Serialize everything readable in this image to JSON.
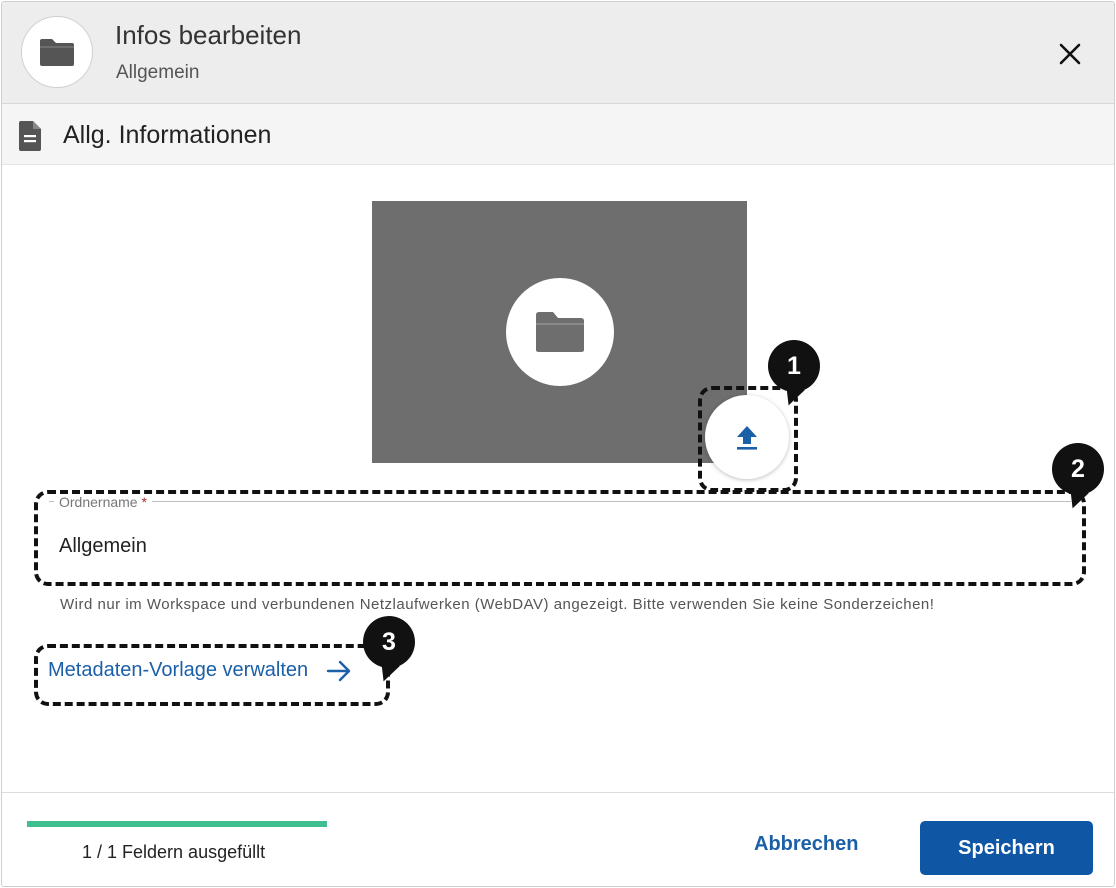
{
  "header": {
    "title": "Infos bearbeiten",
    "subtitle": "Allgemein",
    "icon": "folder-icon",
    "close_icon": "close-icon"
  },
  "section": {
    "title": "Allg. Informationen",
    "icon": "document-icon"
  },
  "image": {
    "placeholder_icon": "folder-icon",
    "upload_icon": "upload-icon"
  },
  "form": {
    "folder_name_label": "Ordnername",
    "required_mark": "*",
    "folder_name_value": "Allgemein",
    "hint": "Wird nur im Workspace und verbundenen Netzlaufwerken (WebDAV) angezeigt. Bitte verwenden Sie keine Sonderzeichen!"
  },
  "metadata_link": {
    "label": "Metadaten-Vorlage verwalten",
    "icon": "arrow-right-icon"
  },
  "annotations": {
    "c1": "1",
    "c2": "2",
    "c3": "3"
  },
  "footer": {
    "progress_fraction": 1.0,
    "progress_text": "1 / 1 Feldern ausgefüllt",
    "cancel_label": "Abbrechen",
    "save_label": "Speichern"
  },
  "colors": {
    "accent": "#0f57a4",
    "link": "#1b5fa8",
    "progress": "#3fbf8f",
    "image_bg": "#6e6e6e",
    "header_bg": "#ededed"
  }
}
